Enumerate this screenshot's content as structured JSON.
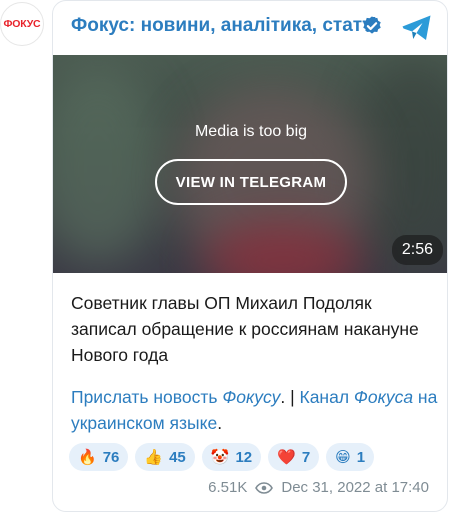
{
  "avatar": {
    "text": "ФОКУС",
    "color": "#e8232b"
  },
  "header": {
    "channel_name": "Фокус: новини, аналітика, статті",
    "verified_icon": "verified-check-icon",
    "telegram_icon": "telegram-logo-icon"
  },
  "media": {
    "message": "Media is too big",
    "button_label": "VIEW IN TELEGRAM",
    "duration": "2:56"
  },
  "post": {
    "text": "Советник главы ОП Михаил Подоляк записал обращение к россиянам накануне Нового года",
    "link1_pre": "Прислать новость ",
    "link1_italic": "Фокусу",
    "link1_post": ".",
    "separator": " | ",
    "link2_pre": "Канал",
    "link2_italic": "Фокуса",
    "link2_post": " на украинском языке",
    "trail": "."
  },
  "reactions": [
    {
      "emoji": "🔥",
      "count": "76"
    },
    {
      "emoji": "👍",
      "count": "45"
    },
    {
      "emoji": "🤡",
      "count": "12"
    },
    {
      "emoji": "❤️",
      "count": "7"
    },
    {
      "emoji": "😁",
      "count": "1"
    }
  ],
  "footer": {
    "views": "6.51K",
    "views_icon": "eye-icon",
    "date": "Dec 31, 2022 at 17:40"
  },
  "colors": {
    "link": "#2c7dbf",
    "reaction_bg": "#e6f0fa",
    "meta": "#7f8c94"
  }
}
